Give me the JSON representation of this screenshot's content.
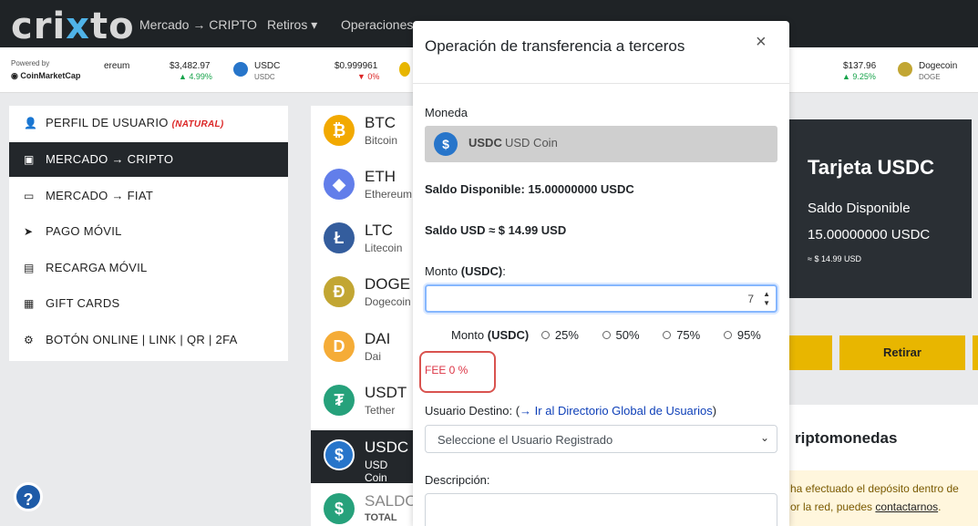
{
  "brand": {
    "logo_pre": "cri",
    "logo_x": "x",
    "logo_post": "to"
  },
  "nav": {
    "mercado": "Mercado → CRIPTO",
    "retiros": "Retiros ▾",
    "operaciones": "Operaciones"
  },
  "ticker": {
    "powered_label": "Powered by",
    "powered_name": "CoinMarketCap",
    "items": [
      {
        "sym": "ereum",
        "price": "$3,482.97",
        "change": "▲ 4.99%",
        "dir": "up"
      },
      {
        "sym": "USDC",
        "sub": "USDC",
        "price": "$0.999961",
        "change": "▼ 0%",
        "dir": "down"
      },
      {
        "price": "$137.96",
        "change": "▲ 9.25%",
        "dir": "up"
      },
      {
        "sym": "Dogecoin",
        "sub": "DOGE"
      }
    ]
  },
  "sidebar": {
    "items": [
      {
        "label": "PERFIL DE USUARIO",
        "tag": "(NATURAL)",
        "icon": "👤"
      },
      {
        "label": "MERCADO → CRIPTO",
        "icon": "▣"
      },
      {
        "label": "MERCADO → FIAT",
        "icon": "▭"
      },
      {
        "label": "PAGO MÓVIL",
        "icon": "➤"
      },
      {
        "label": "RECARGA MÓVIL",
        "icon": "▤"
      },
      {
        "label": "GIFT CARDS",
        "icon": "▦"
      },
      {
        "label": "BOTÓN ONLINE | LINK | QR | 2FA",
        "icon": "⚙"
      }
    ]
  },
  "coins": [
    {
      "sym": "BTC",
      "name": "Bitcoin",
      "glyph": "₿",
      "color": "#f2a900"
    },
    {
      "sym": "ETH",
      "name": "Ethereum",
      "glyph": "◆",
      "color": "#627eea"
    },
    {
      "sym": "LTC",
      "name": "Litecoin",
      "glyph": "Ł",
      "color": "#345d9d"
    },
    {
      "sym": "DOGE",
      "name": "Dogecoin",
      "glyph": "Ð",
      "color": "#c2a633"
    },
    {
      "sym": "DAI",
      "name": "Dai",
      "glyph": "D",
      "color": "#f5ac37"
    },
    {
      "sym": "USDT",
      "name": "Tether",
      "glyph": "₮",
      "color": "#26a17b"
    },
    {
      "sym": "USDC",
      "name": "USD Coin",
      "glyph": "$",
      "color": "#2775ca"
    },
    {
      "sym": "SALDO",
      "name": "TOTAL",
      "glyph": "$",
      "color": "#26a17b"
    }
  ],
  "card": {
    "title": "Tarjeta USDC",
    "saldo_label": "Saldo Disponible",
    "saldo_value": "15.00000000 USDC",
    "saldo_usd": "≈ $ 14.99 USD",
    "retirar": "Retirar"
  },
  "panel": {
    "heading": "riptomonedas",
    "notice_line1": "ha efectuado el depósito dentro de",
    "notice_line2_pre": "or la red, puedes ",
    "notice_link": "contactarnos",
    "notice_post": "."
  },
  "help": {
    "label": "?"
  },
  "modal": {
    "title": "Operación de transferencia a terceros",
    "close": "×",
    "moneda_label": "Moneda",
    "coin_sym": "USDC",
    "coin_name": "USD Coin",
    "saldo_disponible": "Saldo Disponible: 15.00000000 USDC",
    "saldo_usd": "Saldo USD ≈ $ 14.99 USD",
    "monto_label": "Monto ",
    "monto_unit": "(USDC)",
    "monto_colon": ":",
    "monto_value": "7",
    "pct_label": "Monto ",
    "pct_unit": "(USDC)",
    "pct_options": [
      "25%",
      "50%",
      "75%",
      "95%"
    ],
    "fee": "FEE 0 %",
    "dest_label": "Usuario Destino: (",
    "dest_link": "→ Ir al Directorio Global de Usuarios",
    "dest_close": ")",
    "dest_placeholder": "Seleccione el Usuario Registrado",
    "desc_label": "Descripción:"
  }
}
